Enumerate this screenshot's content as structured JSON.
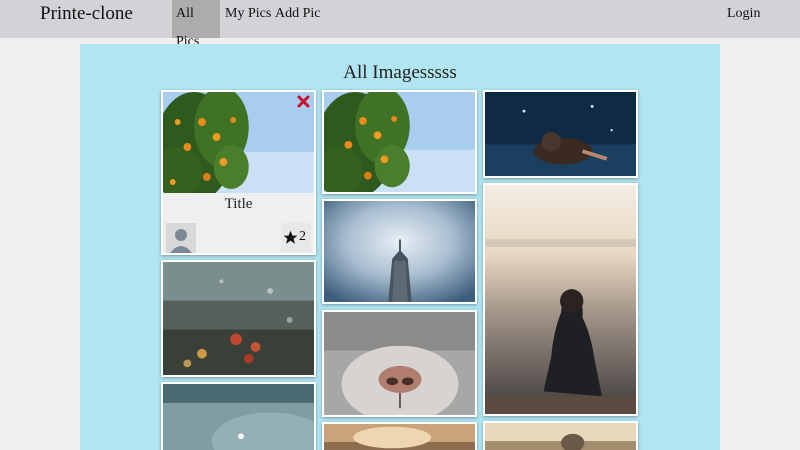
{
  "navbar": {
    "brand": "Printe-clone",
    "links": [
      {
        "label": "All Pics",
        "active": true
      },
      {
        "label": "My Pics",
        "active": false
      },
      {
        "label": "Add Pic",
        "active": false
      }
    ],
    "login": "Login"
  },
  "main": {
    "heading": "All Imagesssss",
    "background": "#b1e5f2",
    "featured_card": {
      "title": "Title",
      "likes": "2",
      "close_icon": "close-icon",
      "like_icon": "star-icon",
      "avatar_icon": "user-avatar-icon"
    }
  }
}
